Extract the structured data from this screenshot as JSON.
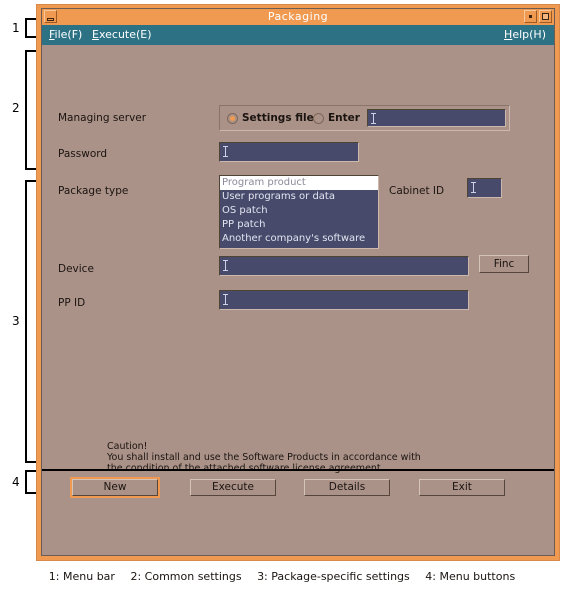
{
  "window": {
    "title": "Packaging",
    "controls": {
      "collapse": "collapse-button",
      "minimize": "minimize-button",
      "maximize": "maximize-button"
    }
  },
  "menu_bar": {
    "items": [
      {
        "label": "File(F)",
        "mnemonic": "F"
      },
      {
        "label": "Execute(E)",
        "mnemonic": "E"
      }
    ],
    "help": {
      "label": "Help(H)",
      "mnemonic": "H"
    }
  },
  "common_settings": {
    "managing_server": {
      "label": "Managing server",
      "radios": [
        {
          "label": "Settings file",
          "checked": true
        },
        {
          "label": "Enter",
          "checked": false
        }
      ],
      "input_value": ""
    },
    "password": {
      "label": "Password",
      "value": ""
    },
    "package_type": {
      "label": "Package type",
      "options": [
        "Program product",
        "User programs or data",
        "OS patch",
        "PP patch",
        "Another company's software"
      ],
      "selected_index": 0
    },
    "cabinet_id": {
      "label": "Cabinet ID",
      "value": ""
    }
  },
  "package_specific_settings": {
    "device": {
      "label": "Device",
      "value": ""
    },
    "find_button": {
      "label": "Finc"
    },
    "pp_id": {
      "label": "PP ID",
      "value": ""
    },
    "caution": {
      "heading": "Caution!",
      "line1": "You shall install and use the Software Products in accordance with",
      "line2": "the condition of the attached software license agreement."
    }
  },
  "menu_buttons": [
    {
      "label": "New",
      "focused": true
    },
    {
      "label": "Execute",
      "focused": false
    },
    {
      "label": "Details",
      "focused": false
    },
    {
      "label": "Exit",
      "focused": false
    }
  ],
  "annotations": {
    "brackets": [
      "1",
      "2",
      "3",
      "4"
    ],
    "legend": [
      "1: Menu bar",
      "2: Common settings",
      "3: Package-specific settings",
      "4: Menu buttons"
    ]
  },
  "colors": {
    "frame": "#ef9a50",
    "client_bg": "#ab9288",
    "menu_bar": "#2d7284",
    "input_bg": "#474a6b",
    "accent": "#ef9a50"
  }
}
